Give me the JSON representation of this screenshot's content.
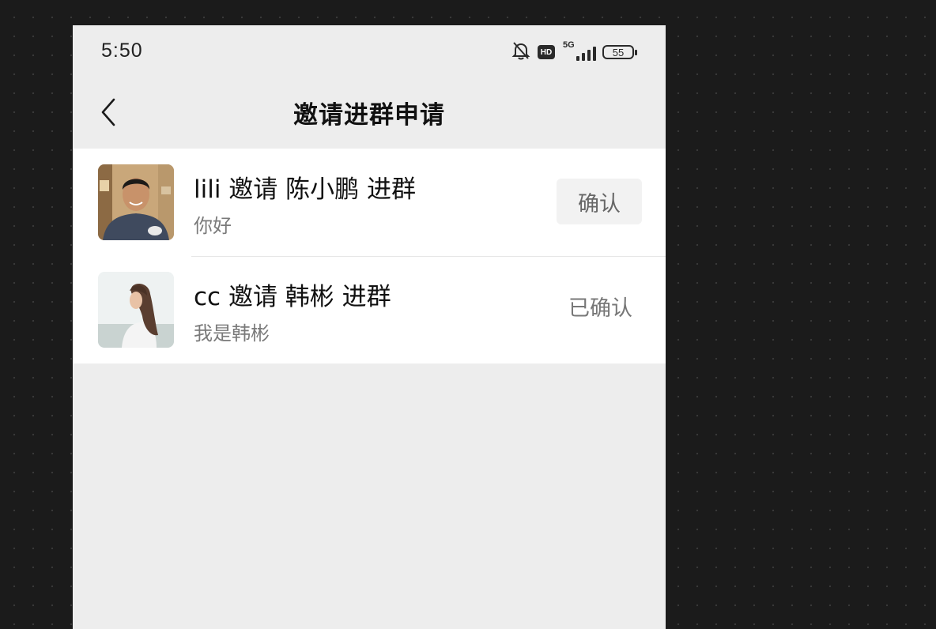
{
  "status_bar": {
    "time": "5:50",
    "icons": [
      "mute-bell-icon",
      "hd-icon",
      "5g-signal-icon",
      "battery-icon"
    ],
    "hd_label": "HD",
    "network": "5G",
    "battery": "55"
  },
  "nav": {
    "title": "邀请进群申请",
    "back_icon": "chevron-left-icon"
  },
  "requests": [
    {
      "message": "lili 邀请 陈小鹏 进群",
      "note": "你好",
      "action_label": "确认",
      "status": "pending"
    },
    {
      "message": "cc 邀请 韩彬 进群",
      "note": "我是韩彬",
      "action_label": "已确认",
      "status": "confirmed"
    }
  ],
  "colors": {
    "background": "#ededed",
    "list_background": "#ffffff",
    "button_background": "#f2f2f2",
    "secondary_text": "#7a7a7a"
  }
}
